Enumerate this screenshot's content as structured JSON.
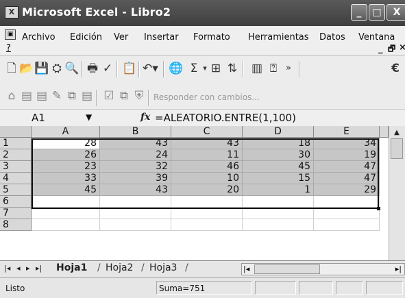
{
  "window": {
    "title": "Microsoft Excel - Libro2",
    "controls": {
      "minimize": "_",
      "maximize": "□",
      "close": "X"
    }
  },
  "menu": {
    "items": [
      "Archivo",
      "Edición",
      "Ver",
      "Insertar",
      "Formato",
      "Herramientas",
      "Datos",
      "Ventana"
    ],
    "help": "?",
    "mdi_min": "_",
    "mdi_restore": "🗗",
    "mdi_close": "×"
  },
  "toolbar_standard": {
    "icons": [
      "new-icon",
      "open-icon",
      "save-icon",
      "permission-icon",
      "search-icon",
      "print-icon",
      "spelling-icon",
      "paste-icon",
      "undo-icon",
      "hyperlink-icon",
      "autosum-icon",
      "function-icon",
      "sort-icon",
      "chart-icon",
      "help-icon",
      "more-icon",
      "euro-icon"
    ],
    "autosum_glyph": "Σ",
    "euro_glyph": "€"
  },
  "toolbar_review": {
    "reply_label": "Responder con cambios..."
  },
  "formula_bar": {
    "name_box": "A1",
    "fx": "fx",
    "formula": "=ALEATORIO.ENTRE(1,100)"
  },
  "sheet": {
    "columns": [
      "A",
      "B",
      "C",
      "D",
      "E"
    ],
    "rows": [
      "1",
      "2",
      "3",
      "4",
      "5",
      "6",
      "7",
      "8"
    ],
    "cells": [
      [
        "28",
        "43",
        "43",
        "18",
        "34"
      ],
      [
        "26",
        "24",
        "11",
        "30",
        "19"
      ],
      [
        "23",
        "32",
        "46",
        "45",
        "47"
      ],
      [
        "33",
        "39",
        "10",
        "15",
        "47"
      ],
      [
        "45",
        "43",
        "20",
        "1",
        "29"
      ]
    ],
    "selection": "A1:E5"
  },
  "tabs": {
    "nav": [
      "|◂",
      "◂",
      "▸",
      "▸|"
    ],
    "sheets": [
      "Hoja1",
      "Hoja2",
      "Hoja3"
    ],
    "active": "Hoja1"
  },
  "status": {
    "mode": "Listo",
    "sum": "Suma=751"
  },
  "colors": {
    "titlebar": "#4a4a4a",
    "selection": "#c6c6c6",
    "header": "#d8d8d8"
  }
}
